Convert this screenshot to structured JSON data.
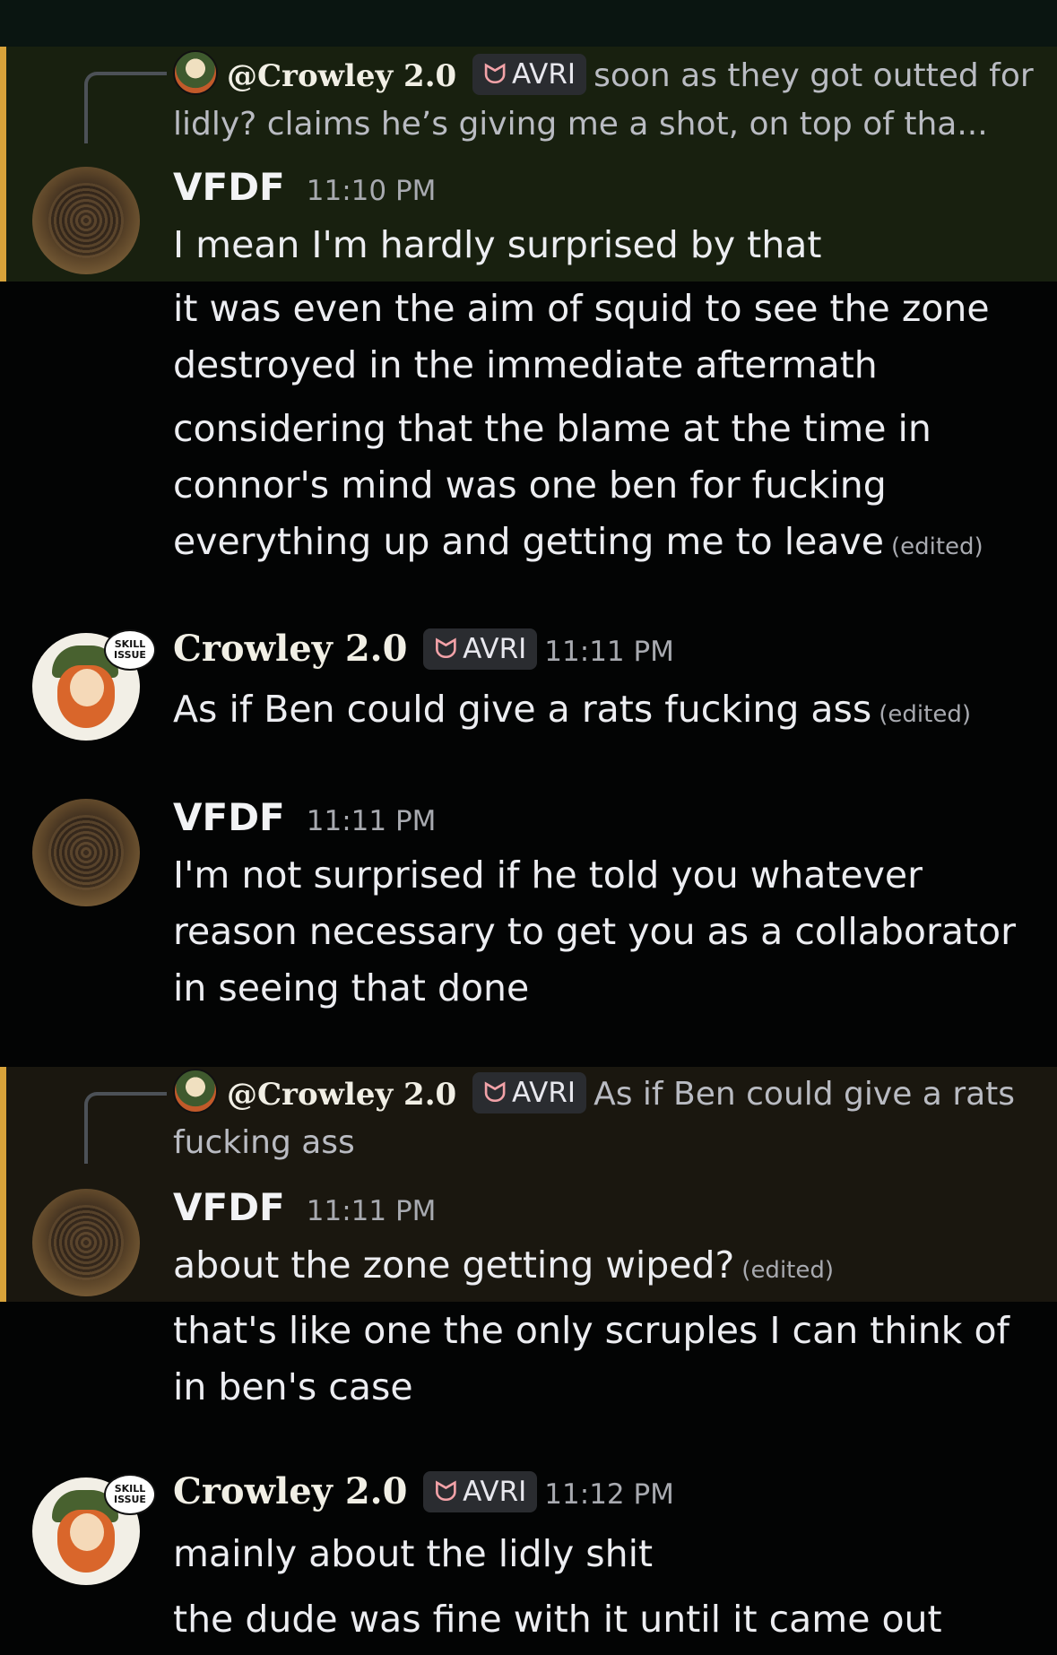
{
  "reply1": {
    "name": "@Crowley 2.0",
    "tag": "AVRI",
    "text": "soon as they got outted for lidly? claims he’s giving me a shot, on top of tha..."
  },
  "m1": {
    "name": "VFDF",
    "time": "11:10 PM",
    "lines": [
      "I mean I'm hardly surprised by that",
      "it was even the aim of squid to see the zone destroyed in the immediate aftermath",
      "considering that the blame at the time in connor's mind was one ben for fucking everything up and getting me to leave"
    ],
    "edited": "(edited)"
  },
  "m2": {
    "name": "Crowley 2.0",
    "tag": "AVRI",
    "time": "11:11 PM",
    "text": "As if Ben could give a rats fucking ass",
    "edited": "(edited)",
    "badge": "SKILL ISSUE"
  },
  "m3": {
    "name": "VFDF",
    "time": "11:11 PM",
    "text": "I'm not surprised if he told you whatever reason necessary to get you as a collaborator in seeing that done"
  },
  "reply2": {
    "name": "@Crowley 2.0",
    "tag": "AVRI",
    "text": "As if Ben could give a rats fucking ass"
  },
  "m4": {
    "name": "VFDF",
    "time": "11:11 PM",
    "lines": [
      "about the zone getting wiped?",
      "that's like one the only scruples I can think of in ben's case"
    ],
    "edited": "(edited)"
  },
  "m5": {
    "name": "Crowley 2.0",
    "tag": "AVRI",
    "time": "11:12 PM",
    "lines": [
      "mainly about the lidly shit",
      "the dude was fine with it until it came out"
    ],
    "badge": "SKILL ISSUE"
  }
}
